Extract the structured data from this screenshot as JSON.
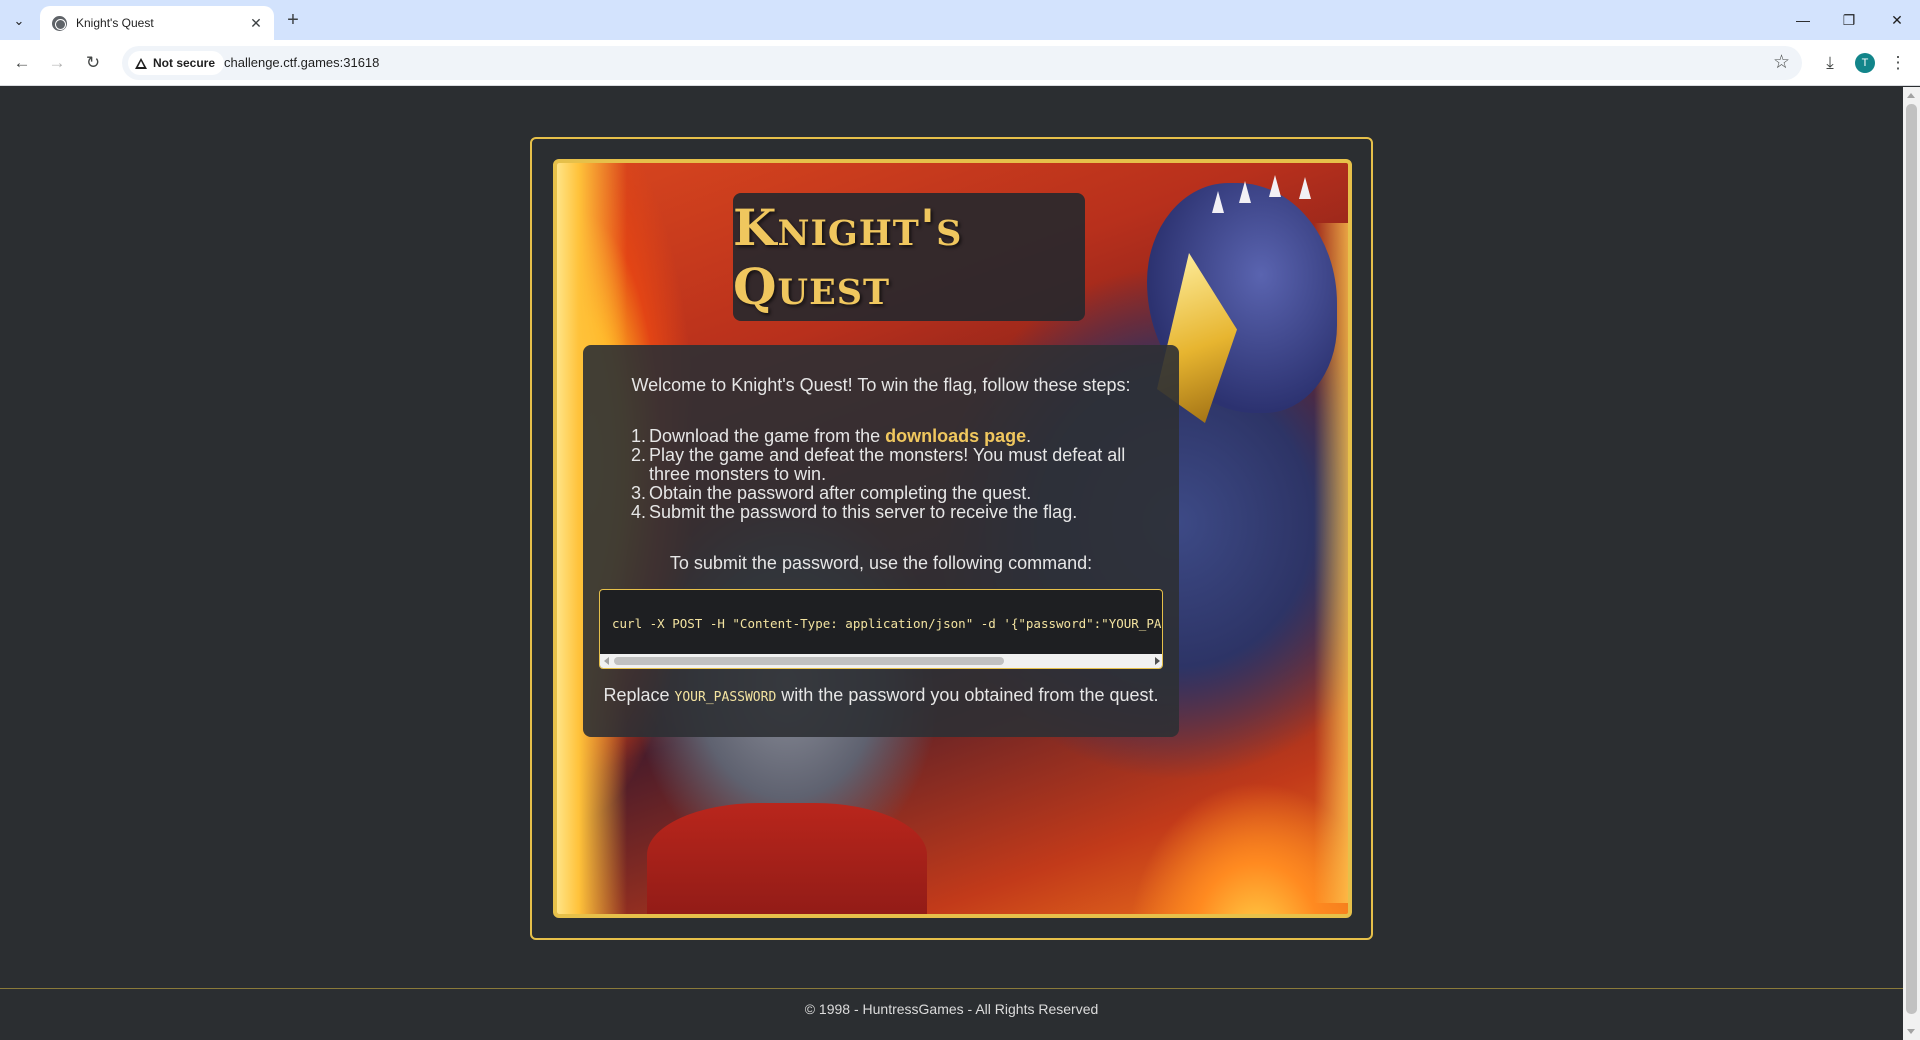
{
  "browser": {
    "tab": {
      "title": "Knight's Quest"
    },
    "security_label": "Not secure",
    "url": "challenge.ctf.games:31618",
    "profile_initial": "T"
  },
  "page": {
    "title": "Knight's Quest",
    "intro": "Welcome to Knight's Quest! To win the flag, follow these steps:",
    "steps": [
      {
        "num": "1.",
        "before": "Download the game from the ",
        "link": "downloads page",
        "after": "."
      },
      {
        "num": "2.",
        "text": "Play the game and defeat the monsters! You must defeat all three monsters to win."
      },
      {
        "num": "3.",
        "text": "Obtain the password after completing the quest."
      },
      {
        "num": "4.",
        "text": "Submit the password to this server to receive the flag."
      }
    ],
    "command_label": "To submit the password, use the following command:",
    "command": "curl -X POST -H \"Content-Type: application/json\" -d '{\"password\":\"YOUR_PASSWORD\"}' htt",
    "replace_before": "Replace ",
    "replace_code": "YOUR_PASSWORD",
    "replace_after": " with the password you obtained from the quest.",
    "footer": "© 1998 - HuntressGames - All Rights Reserved"
  },
  "colors": {
    "accent_gold": "#e6c04a",
    "title_gold": "#f0c75e",
    "page_bg": "#2b2e31"
  },
  "icons": [
    "tab-search-icon",
    "globe-icon",
    "close-icon",
    "plus-icon",
    "minimize-icon",
    "restore-icon",
    "back-icon",
    "forward-icon",
    "reload-icon",
    "warning-icon",
    "star-icon",
    "download-icon",
    "kebab-menu-icon"
  ]
}
